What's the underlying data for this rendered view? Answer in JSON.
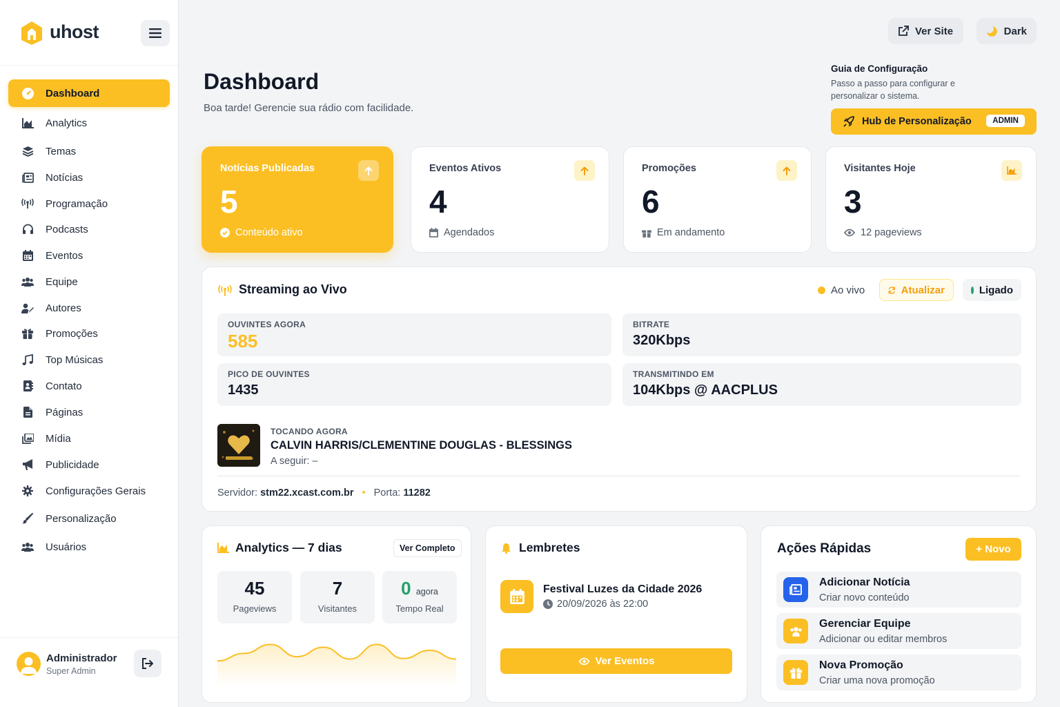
{
  "brand": {
    "name": "uhost"
  },
  "sidebar": {
    "items": [
      {
        "label": "Dashboard",
        "icon": "gauge-icon",
        "active": true
      },
      {
        "label": "Analytics",
        "icon": "chart-area-icon"
      },
      {
        "label": "Temas",
        "icon": "layers-icon"
      },
      {
        "label": "Notícias",
        "icon": "newspaper-icon"
      },
      {
        "label": "Programação",
        "icon": "broadcast-tower-icon"
      },
      {
        "label": "Podcasts",
        "icon": "headphones-icon"
      },
      {
        "label": "Eventos",
        "icon": "calendar-icon"
      },
      {
        "label": "Equipe",
        "icon": "users-icon"
      },
      {
        "label": "Autores",
        "icon": "user-pen-icon"
      },
      {
        "label": "Promoções",
        "icon": "gift-icon"
      },
      {
        "label": "Top Músicas",
        "icon": "music-icon"
      },
      {
        "label": "Contato",
        "icon": "address-book-icon"
      },
      {
        "label": "Páginas",
        "icon": "file-icon"
      },
      {
        "label": "Mídia",
        "icon": "images-icon"
      },
      {
        "label": "Publicidade",
        "icon": "bullhorn-icon"
      },
      {
        "label": "Configurações Gerais",
        "icon": "gear-icon"
      },
      {
        "label": "Personalização",
        "icon": "brush-icon"
      },
      {
        "label": "Usuários",
        "icon": "users-cog-icon"
      }
    ]
  },
  "user": {
    "name": "Administrador",
    "role": "Super Admin"
  },
  "topbar": {
    "view_site": "Ver Site",
    "dark": "Dark"
  },
  "header": {
    "title": "Dashboard",
    "subtitle": "Boa tarde! Gerencie sua rádio com facilidade."
  },
  "guide": {
    "title": "Guia de Configuração",
    "description": "Passo a passo para configurar e personalizar o sistema.",
    "button": "Hub de Personalização",
    "badge": "ADMIN"
  },
  "stats": [
    {
      "title": "Notícias Publicadas",
      "value": "5",
      "foot": "Conteúdo ativo"
    },
    {
      "title": "Eventos Ativos",
      "value": "4",
      "foot": "Agendados"
    },
    {
      "title": "Promoções",
      "value": "6",
      "foot": "Em andamento"
    },
    {
      "title": "Visitantes Hoje",
      "value": "3",
      "foot": "12 pageviews"
    }
  ],
  "streaming": {
    "title": "Streaming ao Vivo",
    "live": "Ao vivo",
    "refresh": "Atualizar",
    "status": "Ligado",
    "metrics": {
      "listeners": {
        "label": "OUVINTES AGORA",
        "value": "585"
      },
      "bitrate": {
        "label": "BITRATE",
        "value": "320Kbps"
      },
      "peak": {
        "label": "PICO DE OUVINTES",
        "value": "1435"
      },
      "transmitting": {
        "label": "TRANSMITINDO EM",
        "value": "104Kbps @ AACPLUS"
      }
    },
    "now_playing_label": "TOCANDO AGORA",
    "song": "CALVIN HARRIS/CLEMENTINE DOUGLAS - BLESSINGS",
    "next": "A seguir: –",
    "server_label": "Servidor:",
    "server": "stm22.xcast.com.br",
    "port_label": "Porta:",
    "port": "11282"
  },
  "analytics": {
    "title": "Analytics — 7 dias",
    "button": "Ver Completo",
    "pageviews": {
      "value": "45",
      "label": "Pageviews"
    },
    "visitors": {
      "value": "7",
      "label": "Visitantes"
    },
    "realtime": {
      "value": "0",
      "suffix": "agora",
      "label": "Tempo Real"
    },
    "sparkline": [
      0.2,
      0.52,
      0.9,
      0.38,
      0.78,
      0.28,
      0.9,
      0.3,
      0.65,
      0.28
    ]
  },
  "reminders": {
    "title": "Lembretes",
    "event_title": "Festival Luzes da Cidade 2026",
    "event_date": "20/09/2026 às 22:00",
    "button": "Ver Eventos"
  },
  "quick_actions": {
    "title": "Ações Rápidas",
    "new_button": "+ Novo",
    "items": [
      {
        "title": "Adicionar Notícia",
        "desc": "Criar novo conteúdo",
        "color": "#2563eb"
      },
      {
        "title": "Gerenciar Equipe",
        "desc": "Adicionar ou editar membros",
        "color": "#fbbf24"
      },
      {
        "title": "Nova Promoção",
        "desc": "Criar uma nova promoção",
        "color": "#fbbf24"
      }
    ]
  },
  "colors": {
    "accent": "#fbbf24",
    "success": "#22a06b",
    "live_dot": "#fbbf24"
  }
}
